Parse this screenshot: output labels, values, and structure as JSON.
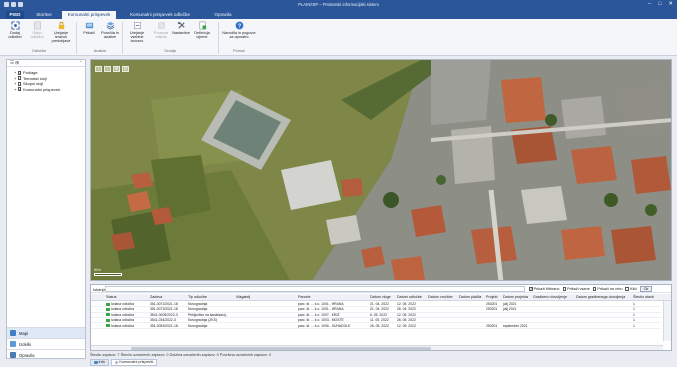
{
  "window": {
    "title": "PLAIN/ISP – Prostorski informacijski sistem",
    "controls": [
      "–",
      "□",
      "✕"
    ]
  },
  "tabs": [
    {
      "label": "PISO",
      "id": "file"
    },
    {
      "label": "Storitve",
      "id": "storitve"
    },
    {
      "label": "Komunalni prispevek",
      "id": "komunalni"
    },
    {
      "label": "Komunalni prispevek odločbe",
      "id": "odlocbe"
    },
    {
      "label": "Opravila",
      "id": "opravila"
    }
  ],
  "ribbon": {
    "buttons": [
      {
        "label": "Dodaj odločbo",
        "icon": "add-decision-icon",
        "enabled": true
      },
      {
        "label": "Odpri odločbo",
        "icon": "open-decision-icon",
        "enabled": false
      },
      {
        "label": "Urejanje izračun predobjave",
        "icon": "edit-lock-icon",
        "enabled": true
      },
      {
        "label": "Prikaži",
        "icon": "show-icon",
        "enabled": true
      },
      {
        "label": "Poročila in analize",
        "icon": "reports-icon",
        "enabled": true
      },
      {
        "label": "Urejanje vsebine izvozov",
        "icon": "edit-export-icon",
        "enabled": true
      },
      {
        "label": "Poravna odkrila",
        "icon": "settlement-icon",
        "enabled": false
      },
      {
        "label": "Nastavitve",
        "icon": "settings-icon",
        "enabled": true
      },
      {
        "label": "Definicija izjeme",
        "icon": "definition-icon",
        "enabled": true
      },
      {
        "label": "Navodila in pogovor za uporabo",
        "icon": "help-icon",
        "enabled": true
      }
    ],
    "groups": [
      "Odločbe",
      "Analize",
      "Orodja",
      "Pomoč"
    ]
  },
  "left_panel": {
    "header": "☰ ⊞",
    "layers": [
      {
        "label": "Podlage",
        "checked": true
      },
      {
        "label": "Tematski sloji",
        "checked": false
      },
      {
        "label": "Skupni sloji",
        "checked": false
      },
      {
        "label": "Komunalni prispevek",
        "checked": true
      }
    ],
    "nav": [
      {
        "label": "Mapi",
        "color": "#3f7fc4",
        "selected": true
      },
      {
        "label": "Izdelki",
        "color": "#5b9bd5",
        "selected": false
      },
      {
        "label": "Opravila",
        "color": "#4a7bb7",
        "selected": false
      }
    ]
  },
  "map": {
    "scale": "50 m"
  },
  "grid": {
    "search_label": "Iskanje:",
    "search_value": "",
    "options": [
      {
        "label": "Prikaži filtrirano",
        "checked": true
      },
      {
        "label": "Prikaži vsane",
        "checked": false
      },
      {
        "label": "Prikaži na vrhu",
        "checked": false
      },
      {
        "label": "Kliči",
        "checked": false
      }
    ],
    "ok_label": "Ok",
    "columns": [
      "",
      "Status",
      "Zadeva",
      "Tip odločbe",
      "Vlagatelj",
      "Parcele",
      "Datum vloge",
      "Datum odločbe",
      "Datum vročitve",
      "Datum plačila",
      "Projekt",
      "Datum projekta",
      "Gradbeno dovoljenje",
      "Datum gradbenega dovoljenja",
      "Število stavb"
    ],
    "rows": [
      [
        "",
        "Izdana odločba",
        "351-0072/2021-18",
        "Novogradnja",
        "",
        "parc. št. ... k.o. 1001 - HRANA",
        "21. 04. 2022",
        "12. 05. 2022",
        "",
        "",
        "253201",
        "julij 2021",
        "",
        "",
        "1"
      ],
      [
        "",
        "Izdana odločba",
        "351-0073/2021-18",
        "Novogradnja",
        "",
        "parc. št. ... k.o. 1001 - HRANA",
        "21. 04. 2022",
        "26. 04. 2022",
        "",
        "",
        "253201",
        "julij 2021",
        "",
        "",
        "1"
      ],
      [
        "",
        "Izdana odločba",
        "3541-0005/2022-3",
        "Priključitev na kanalizacij...",
        "",
        "parc. št. ... k.o. 1007 - KRIŽ",
        "6. 05. 2022",
        "12. 05. 2022",
        "",
        "",
        "",
        "",
        "",
        "",
        "1"
      ],
      [
        "",
        "Izdana odločba",
        "3541-034/2022-3",
        "Novogradnja (ZKS)",
        "",
        "parc. št. ... k.o. 1003 - MOSTE",
        "11. 05. 2022",
        "26. 05. 2022",
        "",
        "",
        "",
        "",
        "",
        "",
        "1"
      ],
      [
        "",
        "Izdana odločba",
        "351-0053/2021-18",
        "Novogradnja",
        "",
        "parc. št. ... k.o. 1006 - SUHADOLE",
        "26. 05. 2022",
        "12. 05. 2022",
        "",
        "",
        "253201",
        "september 2021",
        "",
        "",
        "1"
      ]
    ]
  },
  "footer": {
    "stats": "Število zapisov: 7   Število označenih zapisov: 0   Dolžina označenih zapisov: 0   Površina označenih zapisov: 0"
  },
  "bottom_tabs": [
    {
      "label": "Info",
      "color": "#3f7fc4",
      "active": false
    },
    {
      "label": "Komunalni prispevki",
      "color": "#9fb7d8",
      "active": true
    }
  ]
}
